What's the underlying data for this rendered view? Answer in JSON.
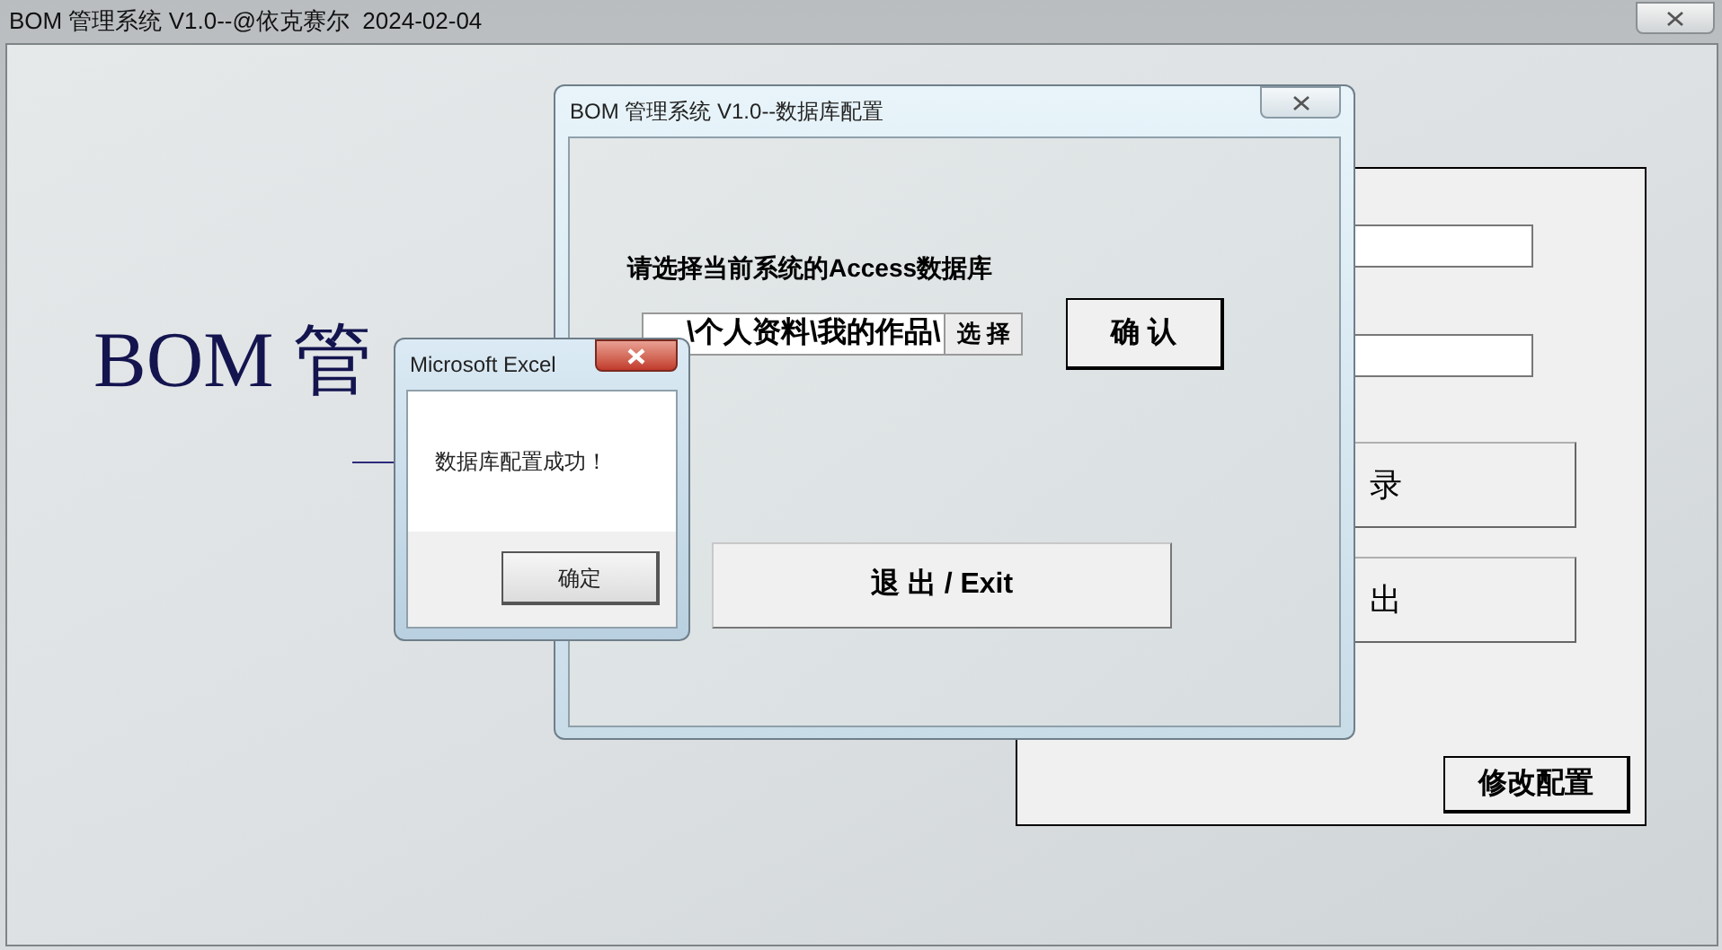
{
  "main_window": {
    "title": "BOM 管理系统 V1.0--@依克赛尔  2024-02-04",
    "heading": "BOM 管"
  },
  "login_panel": {
    "buttons": [
      "录",
      "出"
    ],
    "settings_button": "修改配置"
  },
  "config_dialog": {
    "title": "BOM 管理系统 V1.0--数据库配置",
    "prompt": "请选择当前系统的Access数据库",
    "path_value": "\\个人资料\\我的作品\\",
    "browse_button": "选 择",
    "confirm_button": "确 认",
    "exit_button": "退 出 / Exit"
  },
  "message_box": {
    "title": "Microsoft Excel",
    "message": "数据库配置成功！",
    "ok_button": "确定"
  }
}
